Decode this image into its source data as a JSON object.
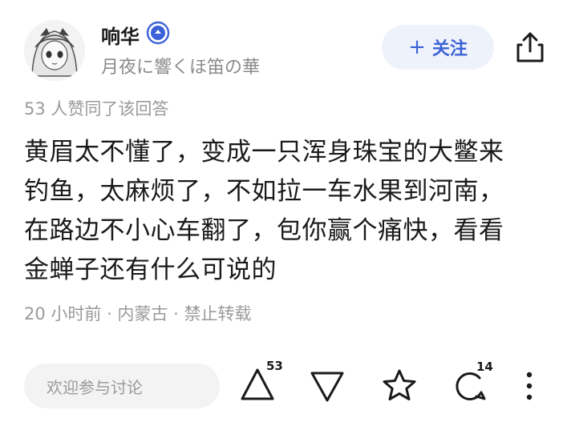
{
  "author": {
    "name": "响华",
    "signature": "月夜に響くほ笛の華",
    "avatar_icon": "anime-avatar",
    "verified_icon": "verified-badge-icon"
  },
  "header": {
    "follow_label": "关注",
    "share_icon": "share-icon"
  },
  "answer": {
    "likes_text": "53 人赞同了该回答",
    "body": "黄眉太不懂了，变成一只浑身珠宝的大鳖来\n钓鱼，太麻烦了，不如拉一车水果到河南，\n在路边不小心车翻了，包你赢个痛快，看看\n金蝉子还有什么可说的",
    "meta": "20 小时前 · 内蒙古 · 禁止转载"
  },
  "actions": {
    "comment_placeholder": "欢迎参与讨论",
    "upvote_count": "53",
    "comment_count": "14"
  },
  "colors": {
    "accent": "#3b62d8",
    "follow_bg": "#eef2fb",
    "muted_text": "#9a9a9a"
  }
}
